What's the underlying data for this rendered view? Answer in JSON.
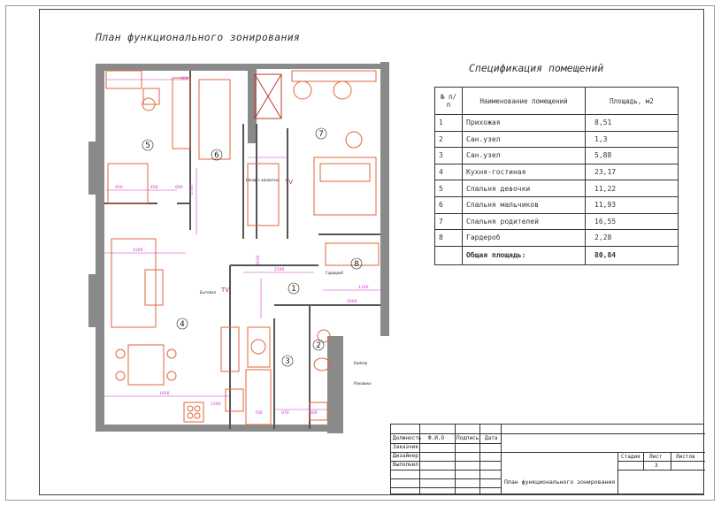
{
  "plan_title": "План функционального зонирования",
  "spec": {
    "title": "Спецификация помещений",
    "headers": [
      "№ п/п",
      "Наименование помещений",
      "Площадь, м2"
    ],
    "rows": [
      {
        "n": "1",
        "name": "Прихожая",
        "area": "8,51"
      },
      {
        "n": "2",
        "name": "Сан.узел",
        "area": "1,3"
      },
      {
        "n": "3",
        "name": "Сан.узел",
        "area": "5,88"
      },
      {
        "n": "4",
        "name": "Кухня-гостиная",
        "area": "23,17"
      },
      {
        "n": "5",
        "name": "Спальня девочки",
        "area": "11,22"
      },
      {
        "n": "6",
        "name": "Спальня мальчиков",
        "area": "11,93"
      },
      {
        "n": "7",
        "name": "Спальня родителей",
        "area": "16,55"
      },
      {
        "n": "8",
        "name": "Гардероб",
        "area": "2,28"
      }
    ],
    "total_label": "Общая площадь:",
    "total_area": "80,84"
  },
  "stamp": {
    "col_headers": [
      "Должность",
      "Ф.И.О",
      "Подпись",
      "Дата"
    ],
    "roles": [
      "Заказчик",
      "Дизайнер",
      "Выполнил"
    ],
    "stage_label": "Стадия",
    "sheet_label": "Лист",
    "sheets_label": "Листов",
    "sheet_number": "3",
    "drawing_title": "План функционального зонирования"
  },
  "plan": {
    "room_numbers": [
      "1",
      "2",
      "3",
      "4",
      "5",
      "6",
      "7",
      "8"
    ],
    "tv_labels": [
      "TV",
      "TV"
    ],
    "dims": [
      "2700",
      "2190",
      "1600",
      "1300",
      "450",
      "600",
      "700",
      "970",
      "800",
      "1100",
      "2000",
      "2010",
      "1500",
      "600",
      "450"
    ],
    "notes": [
      "Шкаф с кроватью",
      "Бытовая",
      "Гардероб",
      "Бойлер",
      "Раковина"
    ]
  },
  "colors": {
    "wall": "#7a7a7a",
    "furniture": "#e0663a",
    "dimension": "#cc33cc",
    "text": "#333333"
  }
}
